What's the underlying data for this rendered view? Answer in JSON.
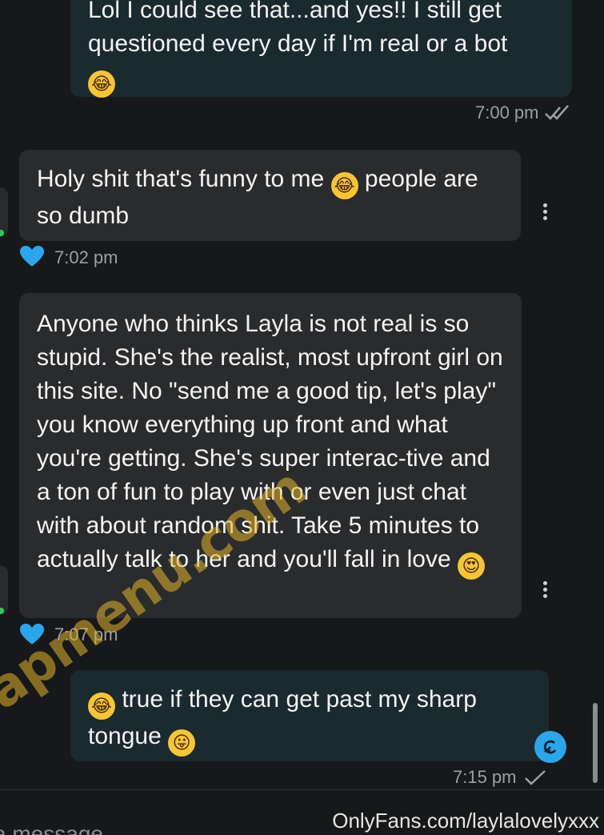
{
  "messages": [
    {
      "text": "Lol I could see that...and yes!! I still get questioned every day if I'm real or a bot",
      "emoji": "😂",
      "time": "7:00 pm"
    },
    {
      "text_before": "Holy shit that's funny to me ",
      "emoji": "😂",
      "text_after": " people are so dumb",
      "time": "7:02 pm"
    },
    {
      "text": "Anyone who thinks Layla is not real is so stupid. She's the realist, most upfront girl on this site. No \"send me a good tip, let's play\" you know everything up front and what you're getting. She's super interac-tive and a ton of fun to play with or even just chat with about random shit. Take 5 minutes to actually talk to her and you'll fall in love ",
      "emoji": "😍",
      "time": "7:07 pm"
    },
    {
      "emoji": "😂",
      "text": " true if they can get past my sharp tongue ",
      "emoji_end": "😛",
      "time": "7:15 pm"
    }
  ],
  "composer": {
    "placeholder": "a message"
  },
  "watermark": "fapmenu.com",
  "credit": "OnlyFans.com/laylalovelyxxx",
  "icons": [
    "double-check-icon",
    "heart-icon",
    "more-options-icon",
    "check-icon",
    "scroll-down-icon"
  ],
  "colors": {
    "accent": "#2aa6ea",
    "background": "#171819",
    "outgoing": "#1b2a2e",
    "incoming": "#2a2b2d"
  }
}
